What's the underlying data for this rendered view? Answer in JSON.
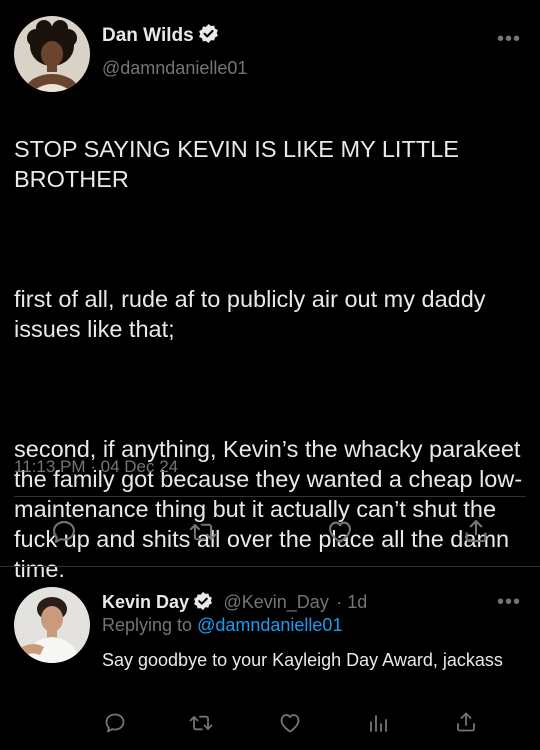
{
  "main_tweet": {
    "author_name": "Dan Wilds",
    "author_handle": "@damndanielle01",
    "paragraph_1": "STOP SAYING KEVIN IS LIKE MY LITTLE BROTHER",
    "paragraph_2": "first of all, rude af to publicly air out my daddy issues like that;",
    "paragraph_3": "second, if anything, Kevin’s the whacky parakeet the family got because they wanted a cheap low-maintenance thing but it actually can’t shut the fuck up and shits all over the place all the damn time.",
    "timestamp": "11:13 PM · 04 Dec 24",
    "more_label": "•••"
  },
  "reply_tweet": {
    "author_name": "Kevin Day",
    "author_handle": "@Kevin_Day",
    "age": "· 1d",
    "replying_prefix": "Replying to",
    "replying_to": "@damndanielle01",
    "text": "Say goodbye to your Kayleigh Day Award, jackass",
    "more_label": "•••"
  },
  "icons": [
    "verified-badge-icon",
    "reply-icon",
    "retweet-icon",
    "like-icon",
    "share-icon",
    "analytics-icon"
  ],
  "colors": {
    "background": "#000000",
    "text": "#e7e9ea",
    "secondary": "#71767b",
    "link": "#1d9bf0",
    "divider": "#2f3336"
  }
}
